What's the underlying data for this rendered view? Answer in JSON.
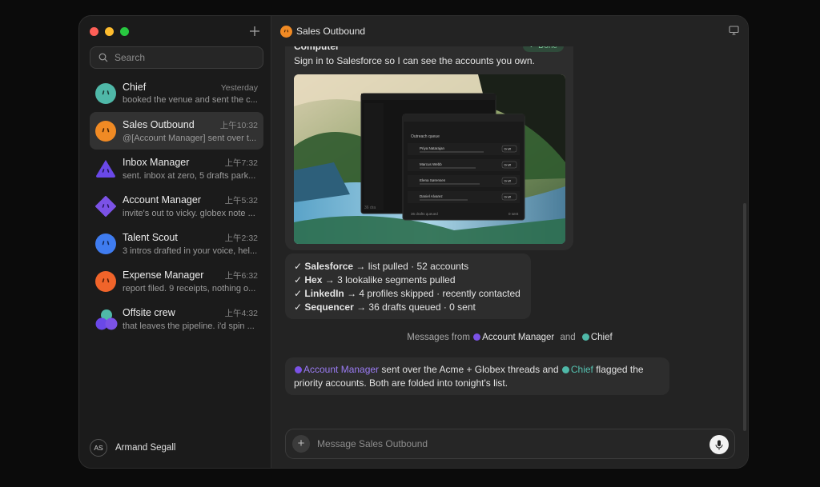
{
  "sidebar": {
    "search_placeholder": "Search",
    "conversations": [
      {
        "name": "Chief",
        "time": "Yesterday",
        "preview": "booked the venue and sent the c...",
        "color": "#4fb8a8",
        "active": false
      },
      {
        "name": "Sales Outbound",
        "time": "上午10:32",
        "preview": "@[Account Manager] sent over t...",
        "color": "#f08a24",
        "active": true
      },
      {
        "name": "Inbox Manager",
        "time": "上午7:32",
        "preview": "sent. inbox at zero, 5 drafts park...",
        "color": "#6a48e8",
        "active": false
      },
      {
        "name": "Account Manager",
        "time": "上午5:32",
        "preview": "invite's out to vicky. globex note ...",
        "color": "#7b52e6",
        "active": false
      },
      {
        "name": "Talent Scout",
        "time": "上午2:32",
        "preview": "3 intros drafted in your voice, hel...",
        "color": "#3f7cf0",
        "active": false
      },
      {
        "name": "Expense Manager",
        "time": "上午6:32",
        "preview": "report filed. 9 receipts, nothing o...",
        "color": "#f0642a",
        "active": false
      },
      {
        "name": "Offsite crew",
        "time": "上午4:32",
        "preview": "that leaves the pipeline. i'd spin ...",
        "color": "#6a48e8",
        "active": false
      }
    ],
    "user": {
      "initials": "AS",
      "name": "Armand Segall"
    }
  },
  "header": {
    "title": "Sales Outbound"
  },
  "computer_message": {
    "label": "Computer",
    "badge": "✓ Done",
    "text": "Sign in to Salesforce so I can see the accounts you own.",
    "screenshot": {
      "panel_title": "Outreach queue",
      "rows": [
        {
          "name": "Priya Natarajan",
          "action": "Draft"
        },
        {
          "name": "Marcus Webb",
          "action": "Draft"
        },
        {
          "name": "Elena Sørensen",
          "action": "Draft"
        },
        {
          "name": "Daniel Alvarez",
          "action": "Draft"
        }
      ],
      "footer_left": "36 drafts queued",
      "footer_right": "0 sent",
      "back_footer": "36 dra"
    }
  },
  "checklist": [
    {
      "tool": "Salesforce",
      "detail": " → list pulled · 52 accounts"
    },
    {
      "tool": "Hex",
      "detail": " → 3 lookalike segments pulled"
    },
    {
      "tool": "LinkedIn",
      "detail": " → 4 profiles skipped · recently contacted"
    },
    {
      "tool": "Sequencer",
      "detail": " → 36 drafts queued · 0 sent"
    }
  ],
  "divider": {
    "prefix": "Messages from",
    "agent1": "Account Manager",
    "joiner": "and",
    "agent2": "Chief"
  },
  "followup": {
    "mention1": "Account Manager",
    "text1": " sent over the Acme + Globex threads and ",
    "mention2": "Chief",
    "text2": " flagged the",
    "line2": "priority accounts. Both are folded into tonight's list."
  },
  "composer": {
    "placeholder": "Message Sales Outbound"
  },
  "colors": {
    "accent_purple": "#9b7cf4",
    "accent_teal": "#55c1b0",
    "done_green": "#7fc79a"
  }
}
